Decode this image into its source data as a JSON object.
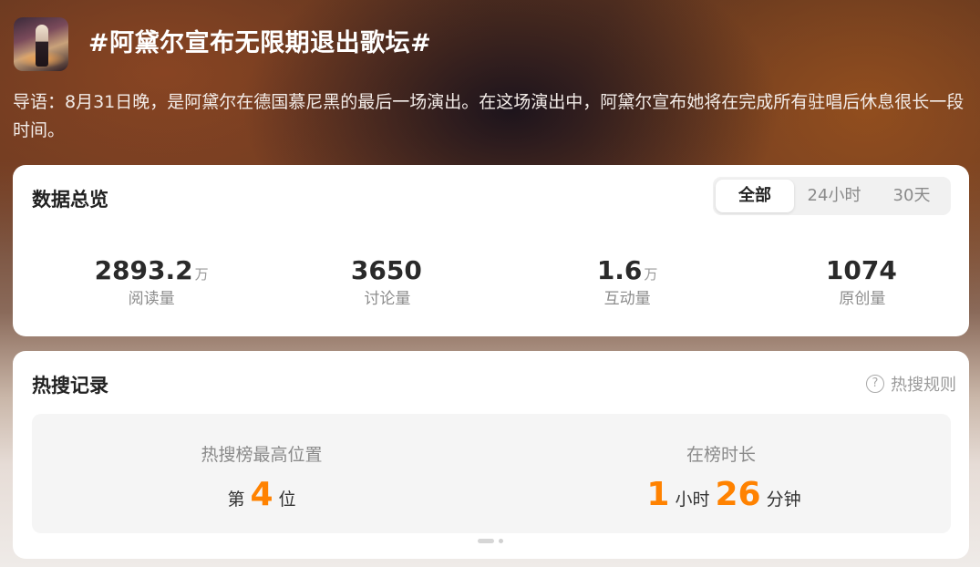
{
  "topic": {
    "title": "#阿黛尔宣布无限期退出歌坛#",
    "intro": "导语：8月31日晚，是阿黛尔在德国慕尼黑的最后一场演出。在这场演出中，阿黛尔宣布她将在完成所有驻唱后休息很长一段时间。"
  },
  "overview": {
    "title": "数据总览",
    "range_tabs": [
      "全部",
      "24小时",
      "30天"
    ],
    "selected_tab": "全部",
    "stats": [
      {
        "value": "2893.2",
        "unit": "万",
        "label": "阅读量"
      },
      {
        "value": "3650",
        "unit": "",
        "label": "讨论量"
      },
      {
        "value": "1.6",
        "unit": "万",
        "label": "互动量"
      },
      {
        "value": "1074",
        "unit": "",
        "label": "原创量"
      }
    ]
  },
  "hot_search": {
    "title": "热搜记录",
    "rules_label": "热搜规则",
    "rules_icon": "help-icon",
    "highest_label": "热搜榜最高位置",
    "highest_prefix": "第",
    "highest_rank": "4",
    "highest_suffix": "位",
    "duration_label": "在榜时长",
    "duration_hours": "1",
    "duration_hours_unit": "小时",
    "duration_minutes": "26",
    "duration_minutes_unit": "分钟"
  },
  "colors": {
    "accent": "#ff8200",
    "card_bg": "#ffffff"
  }
}
